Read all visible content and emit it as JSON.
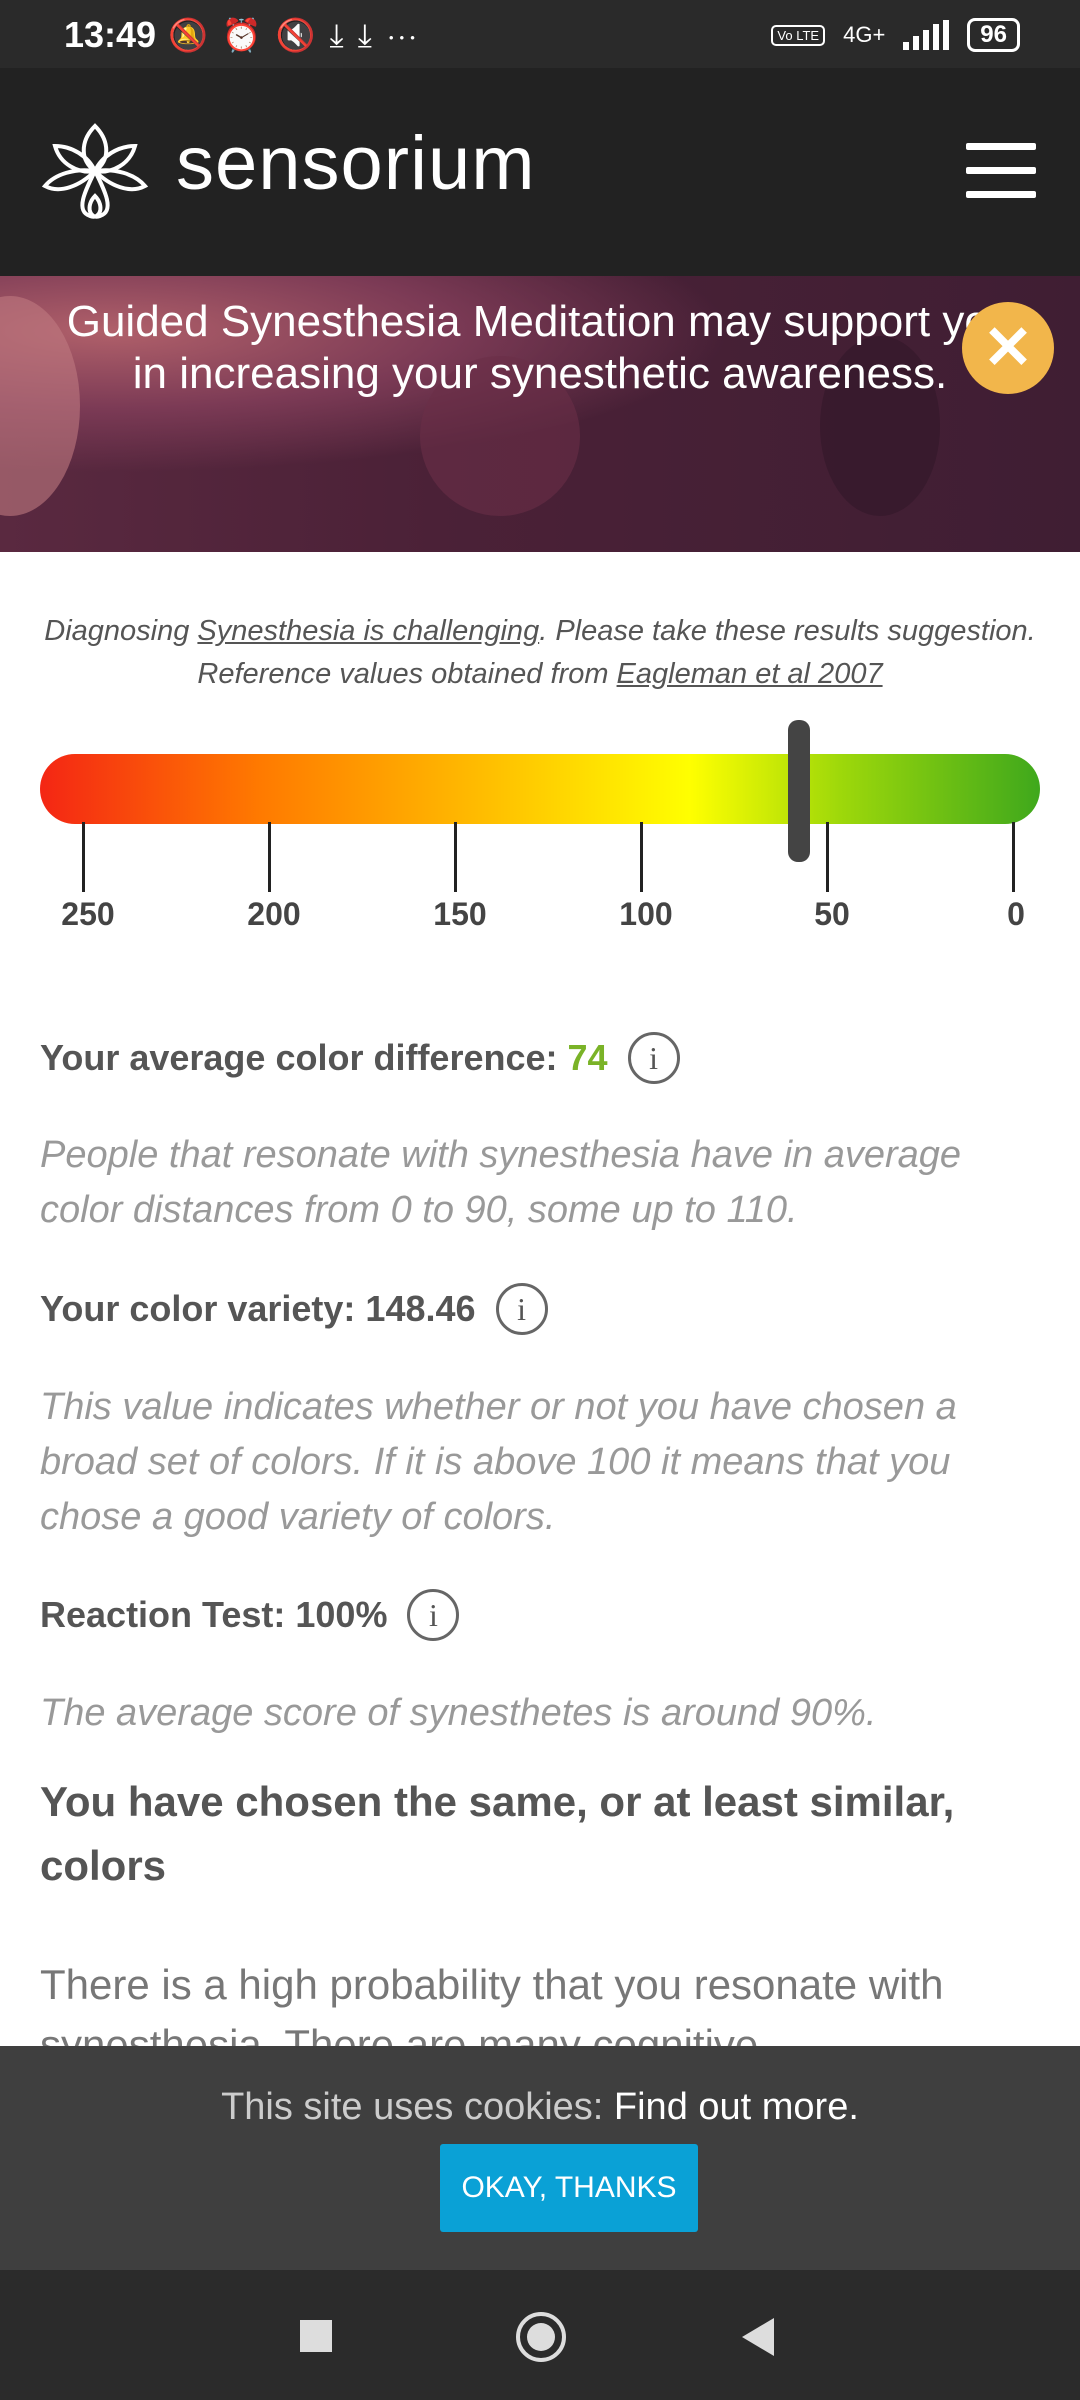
{
  "status_bar": {
    "time": "13:49",
    "icons": [
      "muted-bell-icon",
      "alarm-icon",
      "notifications-off-icon",
      "download-icon",
      "download-icon",
      "more-icon"
    ],
    "network": "4G+",
    "volte": "Vo LTE",
    "battery": "96"
  },
  "header": {
    "brand": "sensorium",
    "logo_icon": "lotus-logo-icon",
    "menu_icon": "hamburger-menu-icon"
  },
  "banner": {
    "text_line1": "Guided Synesthesia Meditation may support you",
    "text_line2": "in increasing your synesthetic awareness.",
    "close_label": "✕"
  },
  "note": {
    "part1": "Diagnosing ",
    "link1": "Synesthesia is challenging",
    "part2": ". Please take these results suggestion. Reference values obtained from ",
    "link2": "Eagleman et al 2007"
  },
  "gauge": {
    "ticks": [
      "250",
      "200",
      "150",
      "100",
      "50",
      "0"
    ],
    "marker_value": 74,
    "colors": [
      "#f42614",
      "#ff7a00",
      "#ffbf00",
      "#ffff00",
      "#9ed80a",
      "#3fa81c"
    ]
  },
  "results": {
    "color_difference_label": "Your average color difference:",
    "color_difference_value": "74",
    "color_difference_desc": "People that resonate with synesthesia have in average color distances from 0 to 90, some up to 110.",
    "color_variety_label": "Your color variety: 148.46",
    "color_variety_desc": "This value indicates whether or not you have chosen a broad set of colors. If it is above 100 it means that you chose a good variety of colors.",
    "reaction_label": "Reaction Test: 100%",
    "reaction_desc": "The average score of synesthetes is around 90%.",
    "heading": "You have chosen the same, or at least similar, colors",
    "body": "There is a high probability that you resonate with synesthesia. There are many cognitive",
    "info_glyph": "i"
  },
  "cookie": {
    "text": "This site uses cookies: ",
    "link": "Find out more.",
    "button": "OKAY, THANKS"
  },
  "navbar": {
    "recents": "recents-square-icon",
    "home": "home-circle-icon",
    "back": "back-triangle-icon"
  }
}
